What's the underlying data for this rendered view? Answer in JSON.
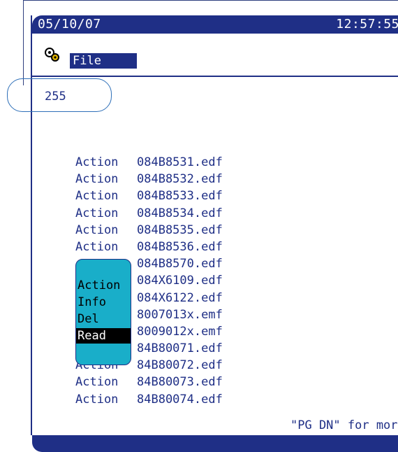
{
  "status_bar": {
    "date": "05/10/07",
    "time": "12:57:55"
  },
  "menu": {
    "file_label": "File",
    "icon": "tools-icon"
  },
  "record_count": "255",
  "files": [
    {
      "action": "Action",
      "name": "084B8531.edf"
    },
    {
      "action": "Action",
      "name": "084B8532.edf"
    },
    {
      "action": "Action",
      "name": "084B8533.edf"
    },
    {
      "action": "Action",
      "name": "084B8534.edf"
    },
    {
      "action": "Action",
      "name": "084B8535.edf"
    },
    {
      "action": "Action",
      "name": "084B8536.edf"
    },
    {
      "action": "",
      "name": "084B8570.edf"
    },
    {
      "action": "",
      "name": "084X6109.edf"
    },
    {
      "action": "",
      "name": "084X6122.edf"
    },
    {
      "action": "",
      "name": "8007013x.emf"
    },
    {
      "action": "",
      "name": "8009012x.emf"
    },
    {
      "action": "",
      "name": "84B80071.edf"
    },
    {
      "action": "Action",
      "name": "84B80072.edf"
    },
    {
      "action": "Action",
      "name": "84B80073.edf"
    },
    {
      "action": "Action",
      "name": "84B80074.edf"
    }
  ],
  "popup_menu": {
    "items": [
      "Action",
      "Info",
      "Del",
      "Read"
    ],
    "selected": "Read"
  },
  "footer_hint": "\"PG DN\" for more",
  "colors": {
    "accent": "#1f2f86",
    "popup": "#19aec9"
  }
}
